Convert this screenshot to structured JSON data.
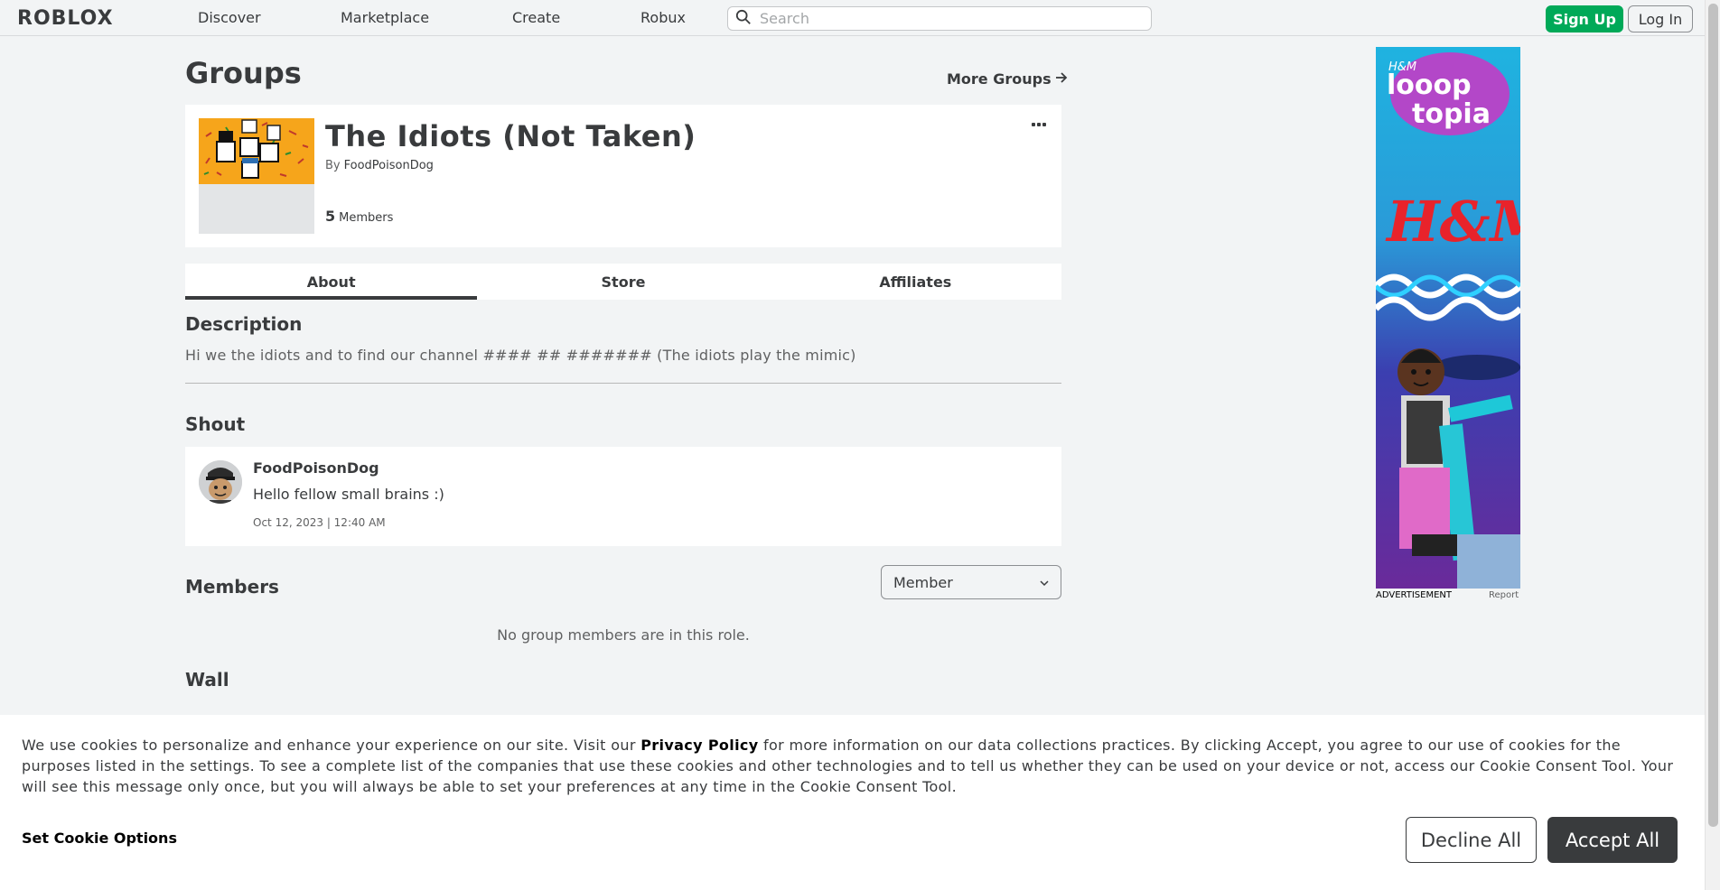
{
  "header": {
    "logo_text": "ROBLOX",
    "nav": [
      "Discover",
      "Marketplace",
      "Create",
      "Robux"
    ],
    "search_placeholder": "Search",
    "signup_label": "Sign Up",
    "login_label": "Log In"
  },
  "page": {
    "title": "Groups",
    "more_groups_label": "More Groups"
  },
  "group": {
    "name": "The Idiots (Not Taken)",
    "by_label": "By",
    "owner": "FoodPoisonDog",
    "member_count": "5",
    "members_label": "Members"
  },
  "tabs": [
    "About",
    "Store",
    "Affiliates"
  ],
  "about": {
    "description_heading": "Description",
    "description": "Hi we the idiots and to find our channel #### ## ####### (The idiots play the mimic)",
    "shout_heading": "Shout",
    "shout": {
      "user": "FoodPoisonDog",
      "text": "Hello fellow small brains :)",
      "date": "Oct 12, 2023 | 12:40 AM"
    },
    "members_heading": "Members",
    "role_selected": "Member",
    "no_members_text": "No group members are in this role.",
    "wall_heading": "Wall"
  },
  "ad": {
    "label": "ADVERTISEMENT",
    "report_label": "Report",
    "brand_top": "H&M",
    "brand_logo_line1": "looop",
    "brand_logo_line2": "topia",
    "brand_big": "H&M"
  },
  "cookie": {
    "text_before": "We use cookies to personalize and enhance your experience on our site. Visit our ",
    "privacy_link": "Privacy Policy",
    "text_after": " for more information on our data collections practices. By clicking Accept, you agree to our use of cookies for the purposes listed in the settings. To see a complete list of the companies that use these cookies and other technologies and to tell us whether they can be used on your device or not, access our Cookie Consent Tool. Your will see this message only once, but you will always be able to set your preferences at any time in the Cookie Consent Tool.",
    "options_label": "Set Cookie Options",
    "decline_label": "Decline All",
    "accept_label": "Accept All"
  },
  "colors": {
    "signup_green": "#00a958",
    "text_dark": "#393b3d",
    "background": "#f2f4f5",
    "emblem_orange": "#f6a51b"
  }
}
